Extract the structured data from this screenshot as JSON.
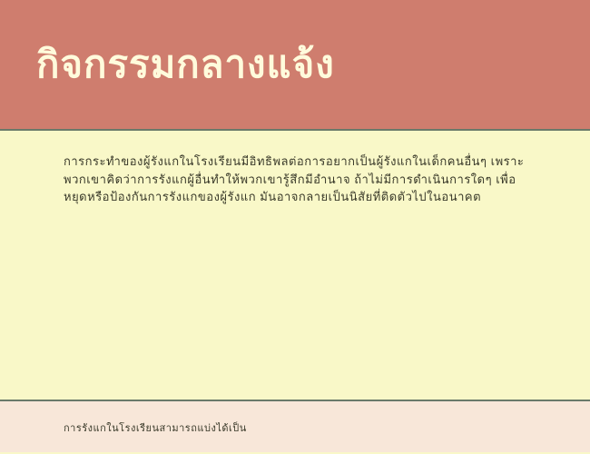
{
  "header": {
    "title": "กิจกรรมกลางแจ้ง"
  },
  "body": {
    "text": "การกระทำของผู้รังแกในโรงเรียนมีอิทธิพลต่อการอยากเป็นผู้รังแกในเด็กคนอื่นๆ เพราะพวกเขาคิดว่าการรังแกผู้อื่นทำให้พวกเขารู้สึกมีอำนาจ ถ้าไม่มีการดำเนินการใดๆ เพื่อหยุดหรือป้องกันการรังแกของผู้รังแก มันอาจกลายเป็นนิสัยที่ติดตัวไปในอนาคต"
  },
  "footer": {
    "text": "การรังแกในโรงเรียนสามารถแบ่งได้เป็น"
  }
}
